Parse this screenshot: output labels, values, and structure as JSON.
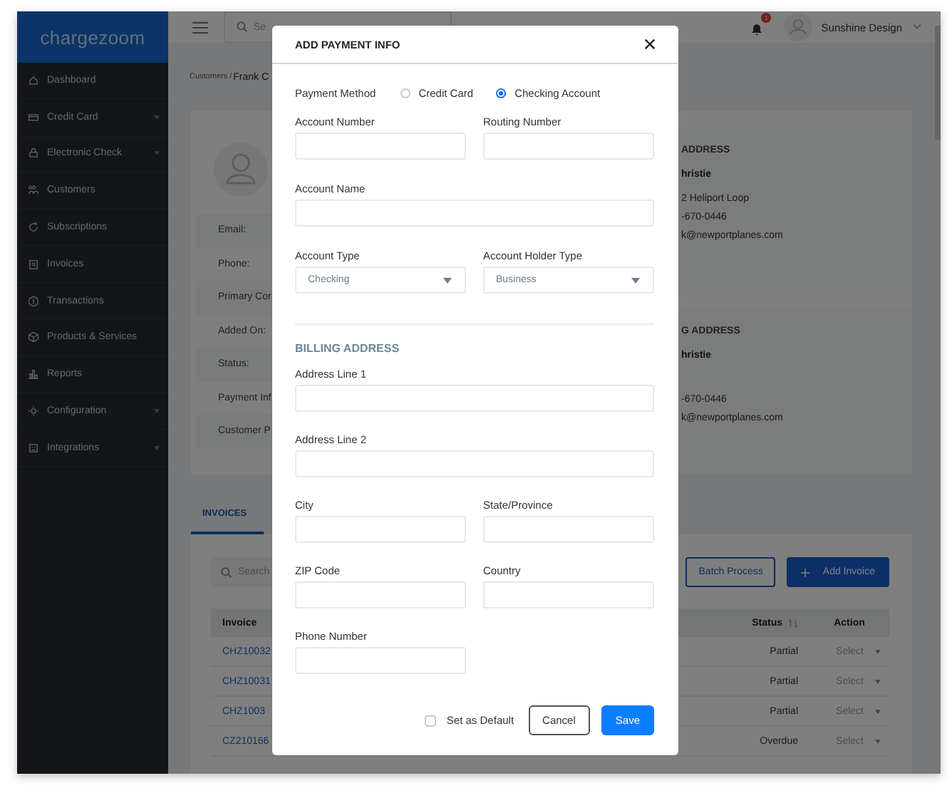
{
  "sidebar": {
    "logo": "chargezoom",
    "items": [
      {
        "label": "Dashboard",
        "submenu": false
      },
      {
        "label": "Credit Card",
        "submenu": true
      },
      {
        "label": "Electronic Check",
        "submenu": true
      },
      {
        "label": "Customers",
        "submenu": false
      },
      {
        "label": "Subscriptions",
        "submenu": false
      },
      {
        "label": "Invoices",
        "submenu": false
      },
      {
        "label": "Transactions",
        "submenu": false
      },
      {
        "label": "Products & Services",
        "submenu": false
      },
      {
        "label": "Reports",
        "submenu": false
      },
      {
        "label": "Configuration",
        "submenu": true
      },
      {
        "label": "Integrations",
        "submenu": true
      }
    ]
  },
  "topbar": {
    "search_placeholder": "Se",
    "notifications": "1",
    "user": "Sunshine Design"
  },
  "breadcrumb": {
    "parent": "Customers /",
    "current": "Frank C"
  },
  "profile": {
    "fields": [
      "Email:",
      "Phone:",
      "Primary Cor",
      "Added On:",
      "Status:",
      "Payment Inf",
      "Customer P"
    ],
    "addresses": [
      {
        "heading": "ADDRESS",
        "name": "hristie",
        "lines": [
          "2 Heliport Loop",
          "-670-0446",
          "k@newportplanes.com"
        ]
      },
      {
        "heading": "G ADDRESS",
        "name": "hristie",
        "lines": [
          "-670-0446",
          "k@newportplanes.com"
        ]
      }
    ]
  },
  "invoices": {
    "tabs": [
      {
        "label": "INVOICES",
        "selected": true
      }
    ],
    "search_placeholder": "Search",
    "buttons": [
      {
        "label": "Batch Process",
        "kind": "outline"
      },
      {
        "label": "Add Invoice",
        "kind": "primary"
      }
    ],
    "columns": [
      "Invoice",
      "Status",
      "Action"
    ],
    "rows": [
      {
        "invoice": "CHZ10032",
        "status": "Partial",
        "action": "Select"
      },
      {
        "invoice": "CHZ10031",
        "status": "Partial",
        "action": "Select"
      },
      {
        "invoice": "CHZ1003",
        "status": "Partial",
        "action": "Select"
      },
      {
        "invoice": "CZ210166",
        "status": "Overdue",
        "action": "Select"
      }
    ]
  },
  "modal": {
    "title": "ADD PAYMENT INFO",
    "payment_method": {
      "label": "Payment Method",
      "options": [
        {
          "label": "Credit Card",
          "selected": false
        },
        {
          "label": "Checking Account",
          "selected": true
        }
      ]
    },
    "rows": [
      {
        "fields": [
          {
            "label": "Account Number",
            "kind": "input",
            "wide": false
          },
          {
            "label": "Routing Number",
            "kind": "input",
            "wide": false
          }
        ]
      },
      {
        "fields": [
          {
            "label": "Account Name",
            "kind": "input",
            "wide": true
          }
        ]
      },
      {
        "fields": [
          {
            "label": "Account Type",
            "kind": "select",
            "wide": false,
            "value": "Checking"
          },
          {
            "label": "Account Holder Type",
            "kind": "select",
            "wide": false,
            "value": "Business"
          }
        ]
      }
    ],
    "section": "BILLING ADDRESS",
    "billing_rows": [
      {
        "fields": [
          {
            "label": "Address Line 1",
            "kind": "input",
            "wide": true
          }
        ]
      },
      {
        "fields": [
          {
            "label": "Address Line 2",
            "kind": "input",
            "wide": true
          }
        ]
      },
      {
        "fields": [
          {
            "label": "City",
            "kind": "input",
            "wide": false
          },
          {
            "label": "State/Province",
            "kind": "input",
            "wide": false
          }
        ]
      },
      {
        "fields": [
          {
            "label": "ZIP Code",
            "kind": "input",
            "wide": false
          },
          {
            "label": "Country",
            "kind": "input",
            "wide": false
          }
        ]
      },
      {
        "fields": [
          {
            "label": "Phone Number",
            "kind": "input",
            "wide": false
          }
        ]
      }
    ],
    "default": {
      "label": "Set as Default",
      "checked": false
    },
    "buttons": [
      {
        "label": "Cancel",
        "kind": "secondary"
      },
      {
        "label": "Save",
        "kind": "primary"
      }
    ]
  }
}
